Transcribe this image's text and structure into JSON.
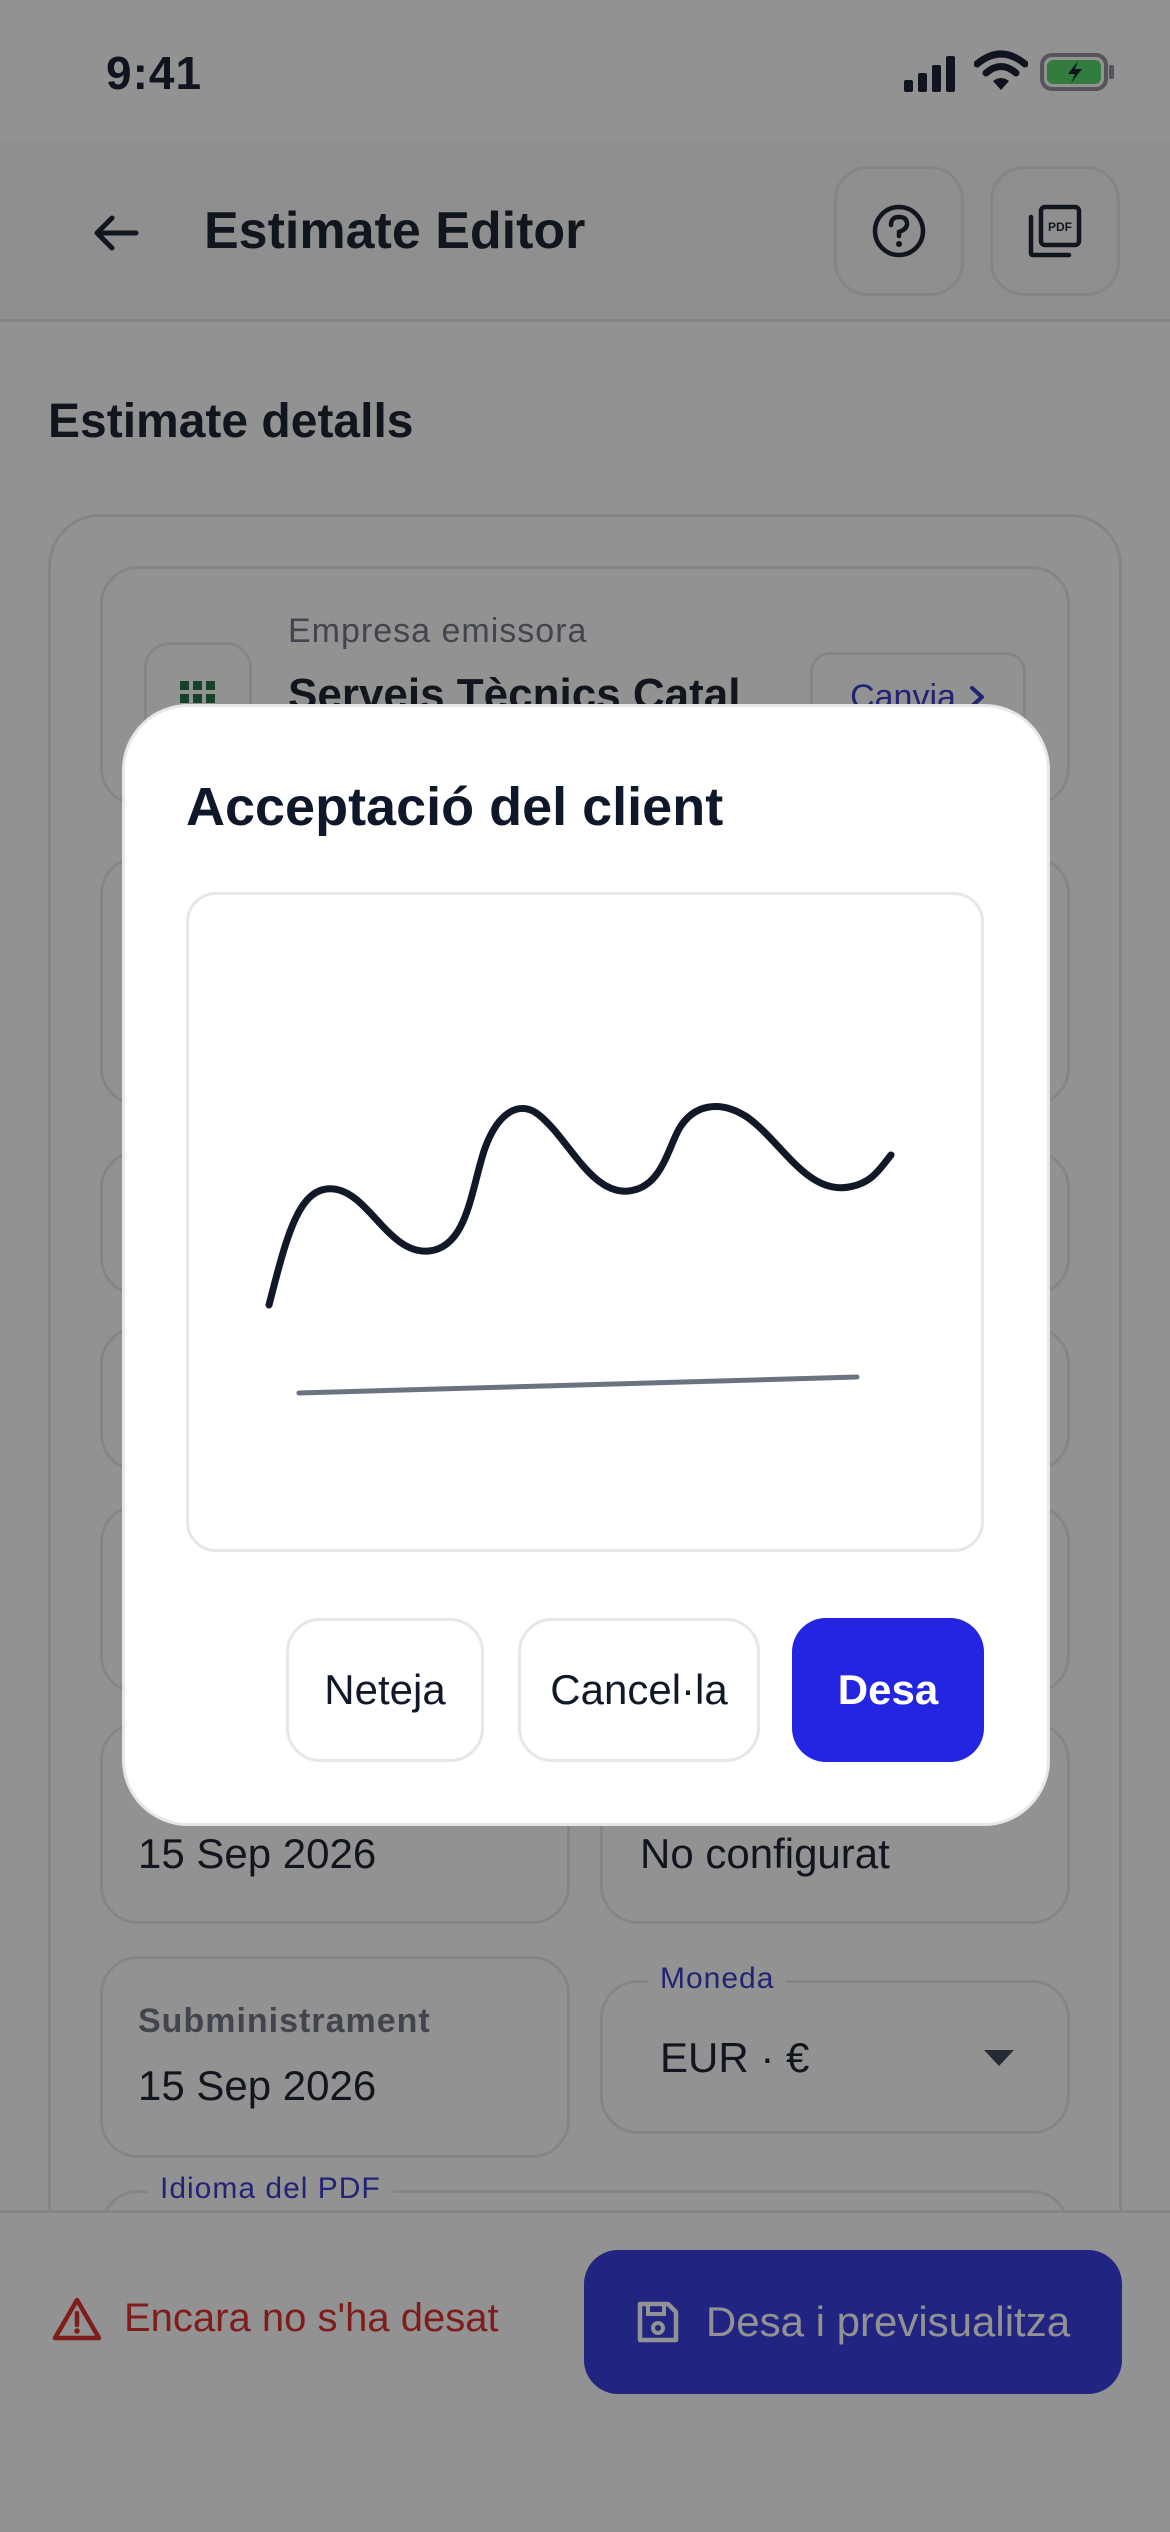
{
  "status_bar": {
    "time": "9:41"
  },
  "header": {
    "title": "Estimate Editor"
  },
  "section": {
    "title": "Estimate detalls"
  },
  "issuer": {
    "label": "Empresa emissora",
    "value": "Serveis Tècnics Catal",
    "change_label": "Canvia"
  },
  "fields": {
    "date_left_value": "15 Sep 2026",
    "date_right_value": "No configurat",
    "supply_label": "Subministrament",
    "supply_value": "15 Sep 2026",
    "currency_legend": "Moneda",
    "currency_value": "EUR · €",
    "pdf_language_legend": "Idioma del PDF"
  },
  "bottom_bar": {
    "unsaved_text": "Encara no s'ha desat",
    "save_preview_label": "Desa i previsualitza"
  },
  "dialog": {
    "title": "Acceptació del client",
    "clear_label": "Neteja",
    "cancel_label": "Cancel·la",
    "save_label": "Desa"
  },
  "colors": {
    "accent": "#2325e0",
    "danger": "#dc2626",
    "border": "#e5e7eb",
    "ink": "#111827"
  }
}
